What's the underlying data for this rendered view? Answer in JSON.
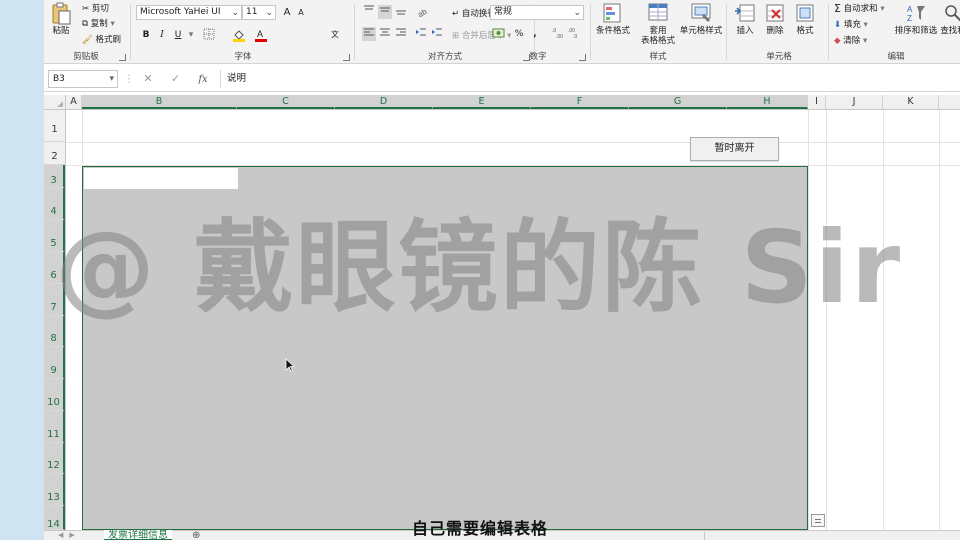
{
  "ribbon": {
    "clipboard": {
      "paste": "粘贴",
      "cut": "剪切",
      "copy": "复制",
      "format_painter": "格式刷",
      "label": "剪贴板"
    },
    "font": {
      "font_name": "Microsoft YaHei UI",
      "font_size": "11",
      "grow": "A",
      "shrink": "A",
      "bold": "B",
      "italic": "I",
      "underline": "U",
      "wen": "文",
      "label": "字体"
    },
    "alignment": {
      "wrap_text": "自动换行",
      "merge_center": "合并后居中",
      "label": "对齐方式"
    },
    "number": {
      "format": "常规",
      "percent": "%",
      "comma": ",",
      "label": "数字"
    },
    "styles": {
      "conditional": "条件格式",
      "table_format_1": "套用",
      "table_format_2": "表格格式",
      "cell_styles": "单元格样式",
      "label": "样式"
    },
    "cells": {
      "insert": "插入",
      "delete": "删除",
      "format": "格式",
      "label": "单元格"
    },
    "editing": {
      "autosum": "自动求和",
      "fill": "填充",
      "clear": "清除",
      "sort_filter": "排序和筛选",
      "find_select": "查找和",
      "label": "编辑"
    }
  },
  "formula_bar": {
    "name_box": "B3",
    "fx": "fx",
    "content": "说明"
  },
  "grid": {
    "columns": [
      "A",
      "B",
      "C",
      "D",
      "E",
      "F",
      "G",
      "H",
      "I",
      "J",
      "K"
    ],
    "rows": [
      "1",
      "2",
      "3",
      "4",
      "5",
      "6",
      "7",
      "8",
      "9",
      "10",
      "11",
      "12",
      "13",
      "14"
    ]
  },
  "leave_button": "暂时离开",
  "sheet_tabs": [
    "发票详细信息"
  ],
  "watermark": "@ 戴眼镜的陈 Sir",
  "subtitle": "自己需要编辑表格",
  "colors": {
    "excel_green": "#217346",
    "ribbon_bg": "#f3f3f3",
    "panel_gray": "#c8c8c8"
  }
}
